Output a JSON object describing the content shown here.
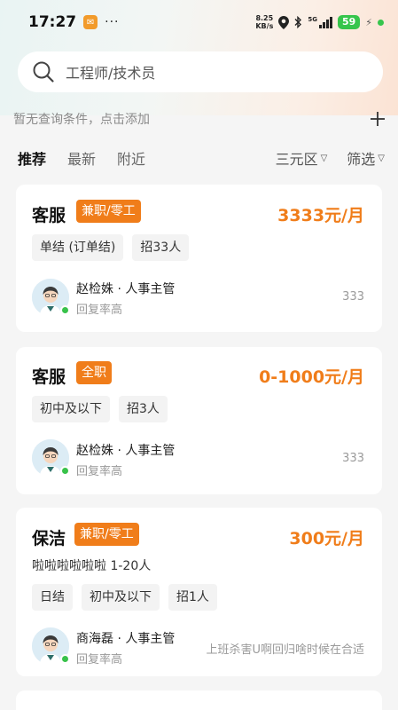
{
  "status_bar": {
    "time": "17:27",
    "dots": "···",
    "speed_value": "8.25",
    "speed_unit": "KB/s",
    "network": "5G",
    "battery": "59"
  },
  "search": {
    "placeholder": "工程师/技术员"
  },
  "hint": {
    "text": "暂无查询条件，点击添加"
  },
  "tabs": [
    {
      "label": "推荐",
      "active": true
    },
    {
      "label": "最新",
      "active": false
    },
    {
      "label": "附近",
      "active": false
    }
  ],
  "filters": {
    "district": "三元区",
    "filter": "筛选"
  },
  "jobs": [
    {
      "title": "客服",
      "tag": "兼职/零工",
      "salary": "3333元/月",
      "description": "",
      "chips": [
        "单结 (订单结)",
        "招33人"
      ],
      "recruiter": "赵检姝 · 人事主管",
      "reply": "回复率高",
      "company": "333"
    },
    {
      "title": "客服",
      "tag": "全职",
      "salary": "0-1000元/月",
      "description": "",
      "chips": [
        "初中及以下",
        "招3人"
      ],
      "recruiter": "赵检姝 · 人事主管",
      "reply": "回复率高",
      "company": "333"
    },
    {
      "title": "保洁",
      "tag": "兼职/零工",
      "salary": "300元/月",
      "description": "啦啦啦啦啦啦 1-20人",
      "chips": [
        "日结",
        "初中及以下",
        "招1人"
      ],
      "recruiter": "商海磊 · 人事主管",
      "reply": "回复率高",
      "company": "上班杀害U啊回归啥时候在合适"
    }
  ],
  "colors": {
    "accent": "#f07d1a",
    "online": "#38c24a",
    "battery": "#36c54c"
  }
}
